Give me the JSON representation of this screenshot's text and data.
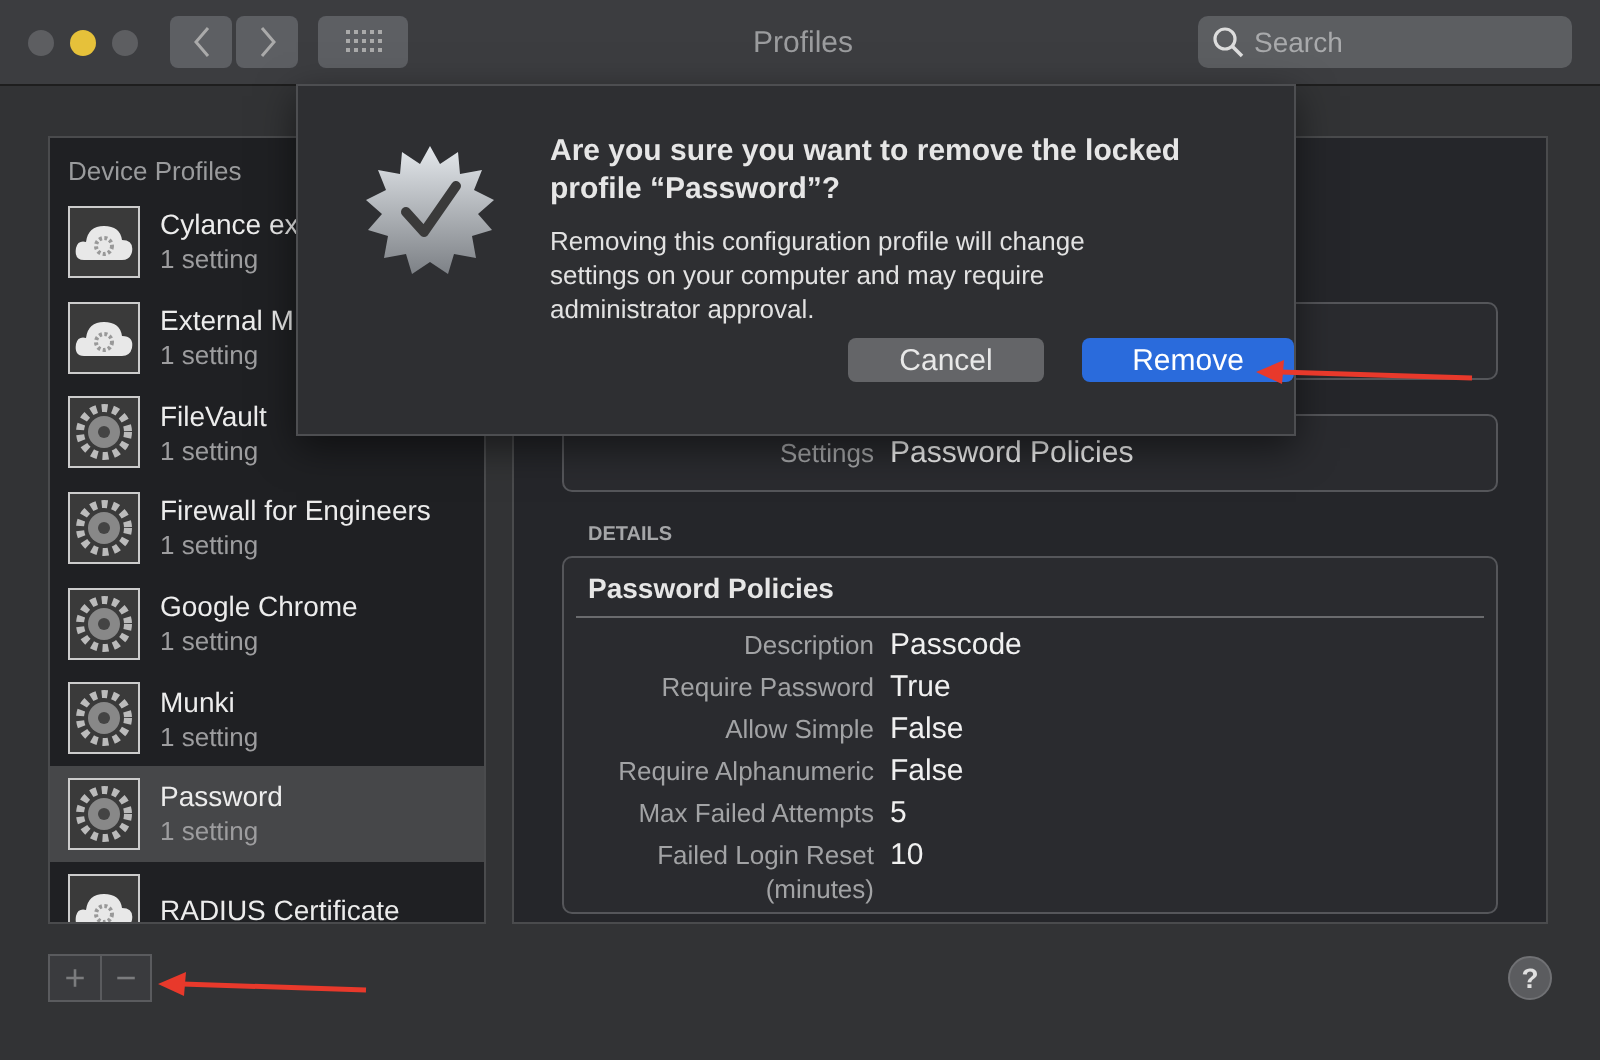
{
  "window": {
    "title": "Profiles"
  },
  "search": {
    "placeholder": "Search"
  },
  "sidebar": {
    "header": "Device Profiles",
    "items": [
      {
        "name": "Cylance ex",
        "detail": "1 setting",
        "kind": "cloud",
        "selected": false
      },
      {
        "name": "External M",
        "detail": "1 setting",
        "kind": "cloud",
        "selected": false
      },
      {
        "name": "FileVault",
        "detail": "1 setting",
        "kind": "gears",
        "selected": false
      },
      {
        "name": "Firewall for Engineers",
        "detail": "1 setting",
        "kind": "gears",
        "selected": false
      },
      {
        "name": "Google Chrome",
        "detail": "1 setting",
        "kind": "gears",
        "selected": false
      },
      {
        "name": "Munki",
        "detail": "1 setting",
        "kind": "gears",
        "selected": false
      },
      {
        "name": "Password",
        "detail": "1 setting",
        "kind": "gears",
        "selected": true
      },
      {
        "name": "RADIUS Certificate",
        "kind": "cloud",
        "selected": false
      }
    ]
  },
  "summary": {
    "label": "Settings",
    "value": "Password Policies"
  },
  "details": {
    "heading": "DETAILS",
    "title": "Password Policies",
    "rows": [
      {
        "label": "Description",
        "value": "Passcode"
      },
      {
        "label": "Require Password",
        "value": "True"
      },
      {
        "label": "Allow Simple",
        "value": "False"
      },
      {
        "label": "Require Alphanumeric",
        "value": "False"
      },
      {
        "label": "Max Failed Attempts",
        "value": "5"
      },
      {
        "label": "Failed Login Reset (minutes)",
        "value": "10"
      }
    ]
  },
  "dialog": {
    "title": "Are you sure you want to remove the locked profile “Password”?",
    "message": "Removing this configuration profile will change settings on your computer and may require administrator approval.",
    "buttons": [
      {
        "label": "Cancel",
        "kind": "secondary"
      },
      {
        "label": "Remove",
        "kind": "primary"
      }
    ]
  },
  "bottom_bar": {
    "add": "+",
    "remove": "−",
    "help": "?"
  }
}
